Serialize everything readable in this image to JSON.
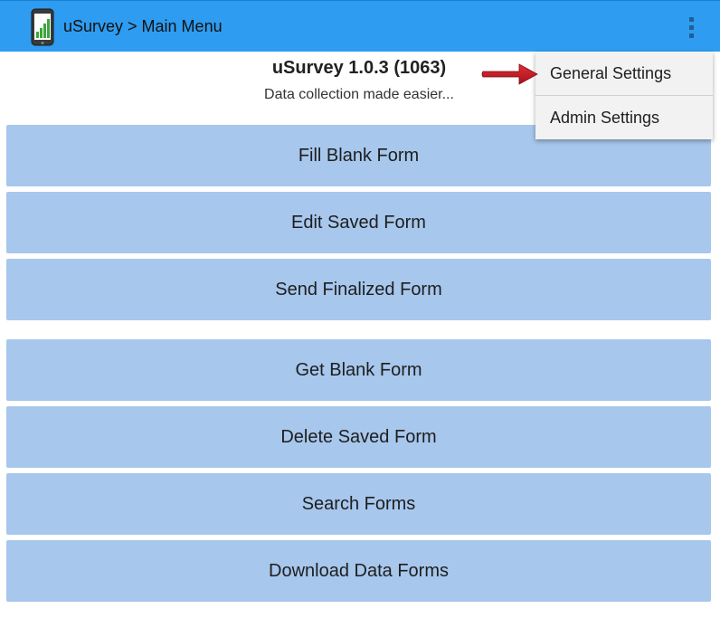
{
  "action_bar": {
    "title": "uSurvey > Main Menu",
    "app_icon": "phone-chart-icon",
    "overflow_icon": "overflow-menu-icon",
    "color": "#2e9cf0"
  },
  "header": {
    "title": "uSurvey 1.0.3 (1063)",
    "subtitle": "Data collection made easier..."
  },
  "menu_buttons": [
    "Fill Blank Form",
    "Edit Saved Form",
    "Send Finalized Form",
    "Get Blank Form",
    "Delete Saved Form",
    "Search Forms",
    "Download Data Forms"
  ],
  "dropdown": {
    "items": [
      "General Settings",
      "Admin Settings"
    ]
  },
  "annotation": {
    "icon": "red-arrow-icon",
    "color": "#c0141e"
  },
  "colors": {
    "button_bg": "#a7c7ec",
    "dropdown_bg": "#f2f2f2"
  }
}
